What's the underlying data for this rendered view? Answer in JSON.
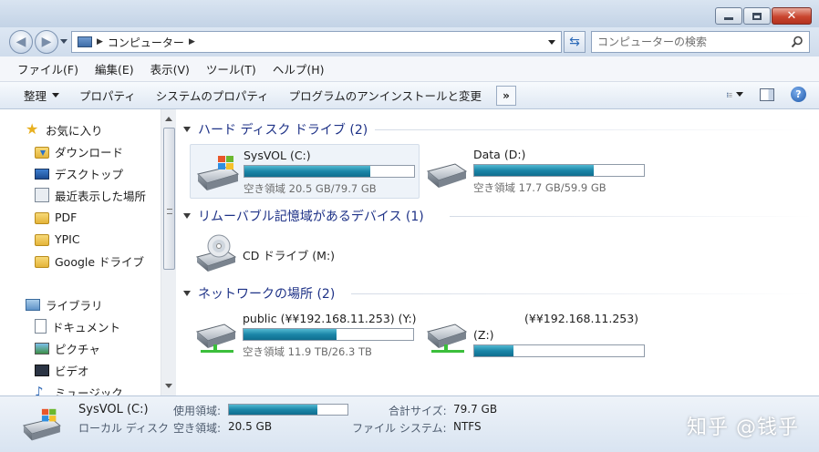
{
  "address": {
    "path_root_label": "コンピューター",
    "search_placeholder": "コンピューターの検索"
  },
  "menubar": {
    "items": [
      "ファイル(F)",
      "編集(E)",
      "表示(V)",
      "ツール(T)",
      "ヘルプ(H)"
    ]
  },
  "commandbar": {
    "organize_label": "整理",
    "properties_label": "プロパティ",
    "system_properties_label": "システムのプロパティ",
    "uninstall_label": "プログラムのアンインストールと変更",
    "more_label": "»",
    "help_label": "?"
  },
  "navpane": {
    "favorites_label": "お気に入り",
    "favorites": [
      "ダウンロード",
      "デスクトップ",
      "最近表示した場所",
      "PDF",
      "YPIC",
      "Google ドライブ"
    ],
    "libraries_label": "ライブラリ",
    "libraries": [
      "ドキュメント",
      "ピクチャ",
      "ビデオ",
      "ミュージック"
    ]
  },
  "groups": {
    "hdd": "ハード ディスク ドライブ (2)",
    "removable": "リムーバブル記憶域があるデバイス (1)",
    "network": "ネットワークの場所 (2)"
  },
  "drives": {
    "c": {
      "name": "SysVOL (C:)",
      "free_text": "空き領域 20.5 GB/79.7 GB",
      "used_fraction": 0.743
    },
    "d": {
      "name": "Data (D:)",
      "free_text": "空き領域 17.7 GB/59.9 GB",
      "used_fraction": 0.704
    },
    "cd": {
      "name": "CD ドライブ (M:)"
    },
    "y": {
      "name": "public (¥¥192.168.11.253) (Y:)",
      "free_text": "空き領域 11.9 TB/26.3 TB",
      "used_fraction": 0.548
    },
    "z": {
      "name_top": "(¥¥192.168.11.253)",
      "name_bottom": "(Z:)",
      "used_fraction": 0.23
    }
  },
  "details": {
    "name": "SysVOL (C:)",
    "type": "ローカル ディスク",
    "used_label": "使用領域:",
    "free_label": "空き領域:",
    "free_value": "20.5 GB",
    "total_label": "合計サイズ:",
    "total_value": "79.7 GB",
    "fs_label": "ファイル システム:",
    "fs_value": "NTFS",
    "used_fraction": 0.743
  },
  "watermark": "知乎 @钱乎",
  "colors": {
    "group_header": "#1e3287",
    "usage_bar": "#1b86a8"
  }
}
